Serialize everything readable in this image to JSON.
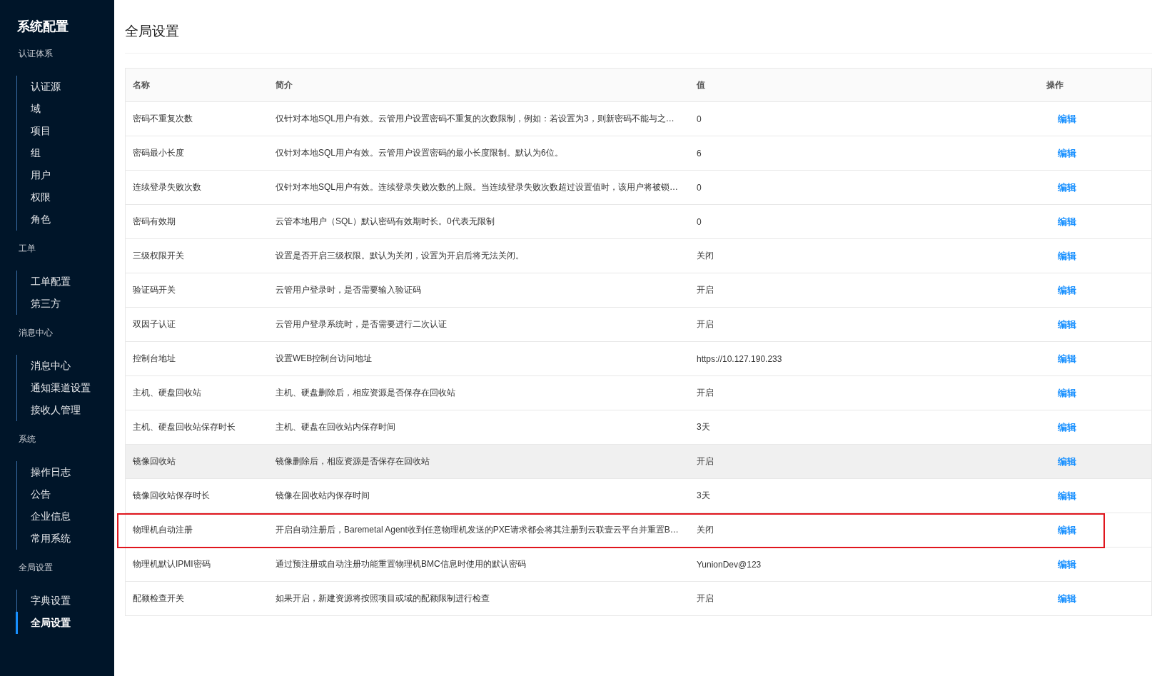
{
  "sidebar": {
    "title": "系统配置",
    "groups": [
      {
        "label": "认证体系",
        "items": [
          {
            "label": "认证源",
            "selected": false
          },
          {
            "label": "域",
            "selected": false
          },
          {
            "label": "项目",
            "selected": false
          },
          {
            "label": "组",
            "selected": false
          },
          {
            "label": "用户",
            "selected": false
          },
          {
            "label": "权限",
            "selected": false
          },
          {
            "label": "角色",
            "selected": false
          }
        ]
      },
      {
        "label": "工单",
        "items": [
          {
            "label": "工单配置",
            "selected": false
          },
          {
            "label": "第三方",
            "selected": false
          }
        ]
      },
      {
        "label": "消息中心",
        "items": [
          {
            "label": "消息中心",
            "selected": false
          },
          {
            "label": "通知渠道设置",
            "selected": false
          },
          {
            "label": "接收人管理",
            "selected": false
          }
        ]
      },
      {
        "label": "系统",
        "items": [
          {
            "label": "操作日志",
            "selected": false
          },
          {
            "label": "公告",
            "selected": false
          },
          {
            "label": "企业信息",
            "selected": false
          },
          {
            "label": "常用系统",
            "selected": false
          }
        ]
      },
      {
        "label": "全局设置",
        "items": [
          {
            "label": "字典设置",
            "selected": false
          },
          {
            "label": "全局设置",
            "selected": true
          }
        ]
      }
    ]
  },
  "page": {
    "title": "全局设置"
  },
  "table": {
    "columns": [
      "名称",
      "简介",
      "值",
      "操作"
    ],
    "rows": [
      {
        "name": "密码不重复次数",
        "description": "仅针对本地SQL用户有效。云管用户设置密码不重复的次数限制，例如：若设置为3，则新密码不能与之…",
        "value": "0",
        "action": "编辑",
        "hovered": false,
        "highlighted": false
      },
      {
        "name": "密码最小长度",
        "description": "仅针对本地SQL用户有效。云管用户设置密码的最小长度限制。默认为6位。",
        "value": "6",
        "action": "编辑",
        "hovered": false,
        "highlighted": false
      },
      {
        "name": "连续登录失败次数",
        "description": "仅针对本地SQL用户有效。连续登录失败次数的上限。当连续登录失败次数超过设置值时，该用户将被锁…",
        "value": "0",
        "action": "编辑",
        "hovered": false,
        "highlighted": false
      },
      {
        "name": "密码有效期",
        "description": "云管本地用户（SQL）默认密码有效期时长。0代表无限制",
        "value": "0",
        "action": "编辑",
        "hovered": false,
        "highlighted": false
      },
      {
        "name": "三级权限开关",
        "description": "设置是否开启三级权限。默认为关闭，设置为开启后将无法关闭。",
        "value": "关闭",
        "action": "编辑",
        "hovered": false,
        "highlighted": false
      },
      {
        "name": "验证码开关",
        "description": "云管用户登录时，是否需要输入验证码",
        "value": "开启",
        "action": "编辑",
        "hovered": false,
        "highlighted": false
      },
      {
        "name": "双因子认证",
        "description": "云管用户登录系统时，是否需要进行二次认证",
        "value": "开启",
        "action": "编辑",
        "hovered": false,
        "highlighted": false
      },
      {
        "name": "控制台地址",
        "description": "设置WEB控制台访问地址",
        "value": "https://10.127.190.233",
        "action": "编辑",
        "hovered": false,
        "highlighted": false
      },
      {
        "name": "主机、硬盘回收站",
        "description": "主机、硬盘删除后，相应资源是否保存在回收站",
        "value": "开启",
        "action": "编辑",
        "hovered": false,
        "highlighted": false
      },
      {
        "name": "主机、硬盘回收站保存时长",
        "description": "主机、硬盘在回收站内保存时间",
        "value": "3天",
        "action": "编辑",
        "hovered": false,
        "highlighted": false
      },
      {
        "name": "镜像回收站",
        "description": "镜像删除后，相应资源是否保存在回收站",
        "value": "开启",
        "action": "编辑",
        "hovered": true,
        "highlighted": false
      },
      {
        "name": "镜像回收站保存时长",
        "description": "镜像在回收站内保存时间",
        "value": "3天",
        "action": "编辑",
        "hovered": false,
        "highlighted": false
      },
      {
        "name": "物理机自动注册",
        "description": "开启自动注册后，Baremetal Agent收到任意物理机发送的PXE请求都会将其注册到云联壹云平台并重置B…",
        "value": "关闭",
        "action": "编辑",
        "hovered": false,
        "highlighted": true
      },
      {
        "name": "物理机默认IPMI密码",
        "description": "通过预注册或自动注册功能重置物理机BMC信息时使用的默认密码",
        "value": "YunionDev@123",
        "action": "编辑",
        "hovered": false,
        "highlighted": false
      },
      {
        "name": "配额检查开关",
        "description": "如果开启，新建资源将按照项目或域的配额限制进行检查",
        "value": "开启",
        "action": "编辑",
        "hovered": false,
        "highlighted": false
      }
    ]
  }
}
